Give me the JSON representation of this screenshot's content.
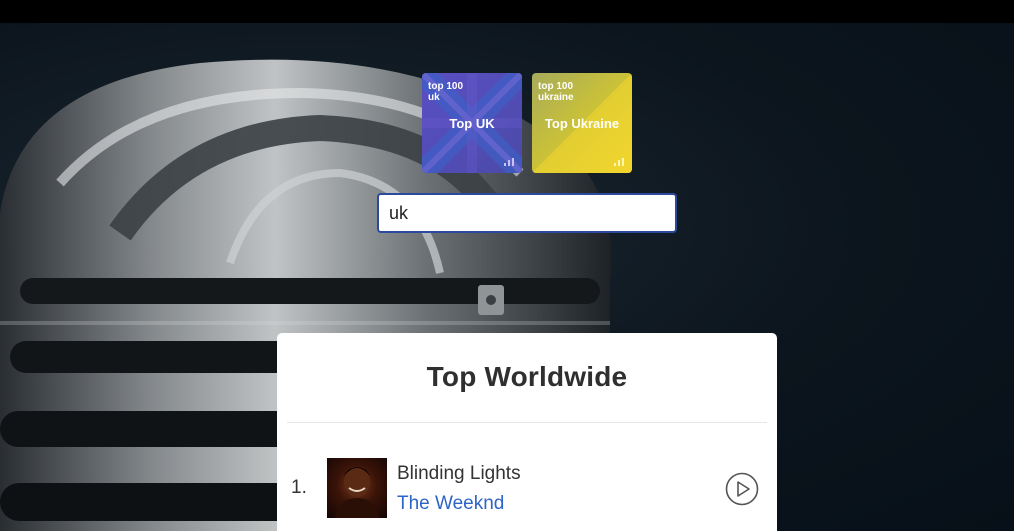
{
  "playlists": [
    {
      "small_label": "top 100\nuk",
      "title": "Top UK"
    },
    {
      "small_label": "top 100\nukraine",
      "title": "Top Ukraine"
    }
  ],
  "search": {
    "value": "uk"
  },
  "chart": {
    "heading": "Top Worldwide",
    "tracks": [
      {
        "rank": "1.",
        "title": "Blinding Lights",
        "artist": "The Weeknd"
      }
    ]
  },
  "colors": {
    "artist_link": "#2f64c7",
    "search_border": "#2b4a9e",
    "uk_card": "#5a4fc4",
    "ukraine_card": "#f1d22c"
  },
  "icons": {
    "play": "play-circle-icon",
    "chart_bars": "bars-icon"
  }
}
